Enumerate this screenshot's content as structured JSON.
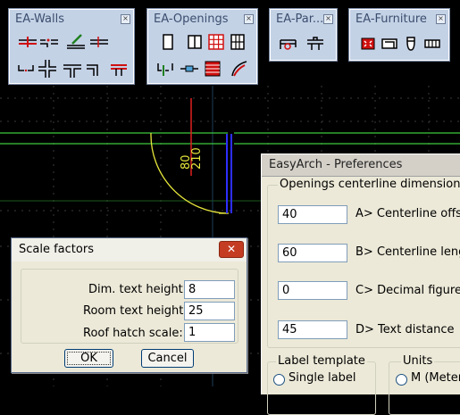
{
  "palettes": {
    "walls": {
      "title": "EA-Walls",
      "close": "x"
    },
    "openings": {
      "title": "EA-Openings",
      "close": "x"
    },
    "parts": {
      "title": "EA-Par...",
      "close": "x"
    },
    "furniture": {
      "title": "EA-Furniture",
      "close": "x"
    }
  },
  "drawing": {
    "dim_a": "80",
    "dim_b": "210"
  },
  "preferences": {
    "title": "EasyArch - Preferences",
    "section": "Openings centerline dimensions",
    "rows": [
      {
        "value": "40",
        "label": "A> Centerline offset"
      },
      {
        "value": "60",
        "label": "B> Centerline length"
      },
      {
        "value": "0",
        "label": "C> Decimal figures"
      },
      {
        "value": "45",
        "label": "D> Text distance"
      }
    ],
    "label_template": {
      "title": "Label template",
      "option": "Single label"
    },
    "units": {
      "title": "Units",
      "option": "M (Meters)"
    }
  },
  "scale_dialog": {
    "title": "Scale factors",
    "close": "✕",
    "rows": [
      {
        "label": "Dim. text height:",
        "value": "8"
      },
      {
        "label": "Room text height:",
        "value": "25"
      },
      {
        "label": "Roof hatch scale:",
        "value": "1"
      }
    ],
    "ok": "OK",
    "cancel": "Cancel"
  }
}
